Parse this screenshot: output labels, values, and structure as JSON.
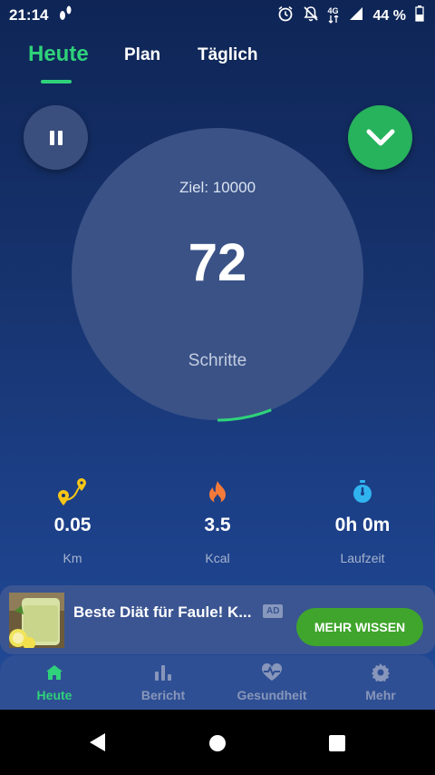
{
  "status_bar": {
    "time": "21:14",
    "battery": "44 %",
    "network": "4G"
  },
  "tabs": [
    {
      "label": "Heute",
      "active": true
    },
    {
      "label": "Plan",
      "active": false
    },
    {
      "label": "Täglich",
      "active": false
    }
  ],
  "progress": {
    "goal_label": "Ziel: 10000",
    "steps": "72",
    "steps_label": "Schritte",
    "fraction": 0.0072
  },
  "stats": [
    {
      "icon": "route-icon",
      "value": "0.05",
      "unit": "Km"
    },
    {
      "icon": "flame-icon",
      "value": "3.5",
      "unit": "Kcal"
    },
    {
      "icon": "stopwatch-icon",
      "value": "0h 0m",
      "unit": "Laufzeit"
    }
  ],
  "ad": {
    "title": "Beste Diät für Faule! K...",
    "badge": "AD",
    "cta": "MEHR WISSEN"
  },
  "bottom_nav": [
    {
      "icon": "home-icon",
      "label": "Heute",
      "active": true
    },
    {
      "icon": "bar-chart-icon",
      "label": "Bericht",
      "active": false
    },
    {
      "icon": "heart-pulse-icon",
      "label": "Gesundheit",
      "active": false
    },
    {
      "icon": "gear-icon",
      "label": "Mehr",
      "active": false
    }
  ],
  "colors": {
    "accent": "#2fd27a",
    "background": "#17336e",
    "cta": "#3fa52c"
  }
}
